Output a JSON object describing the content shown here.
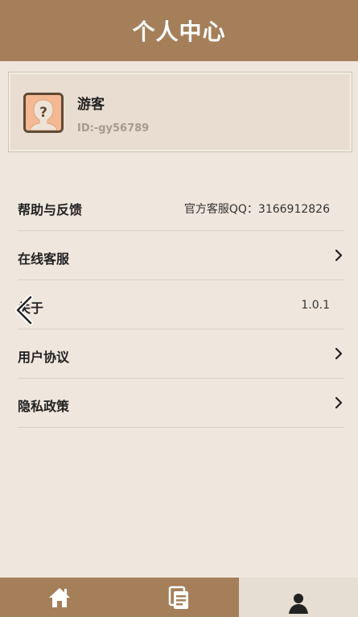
{
  "header": {
    "title": "个人中心"
  },
  "profile": {
    "name": "游客",
    "id": "ID:-gy56789",
    "avatar_icon": "avatar-question-icon"
  },
  "menu": {
    "items": [
      {
        "label": "帮助与反馈",
        "value": "官方客服QQ：3166912826"
      },
      {
        "label": "在线客服",
        "icon": "chevron-right-icon"
      },
      {
        "label": "关于",
        "value": "1.0.1"
      },
      {
        "label": "用户协议",
        "icon": "chevron-right-icon"
      },
      {
        "label": "隐私政策",
        "icon": "chevron-right-icon"
      }
    ]
  },
  "tabbar": {
    "items": [
      {
        "icon": "home-icon"
      },
      {
        "icon": "notes-icon"
      },
      {
        "icon": "user-icon",
        "active": true
      }
    ]
  },
  "colors": {
    "header": "#a57f5a",
    "background": "#efe7de",
    "profile_card": "#e8ddd0"
  }
}
